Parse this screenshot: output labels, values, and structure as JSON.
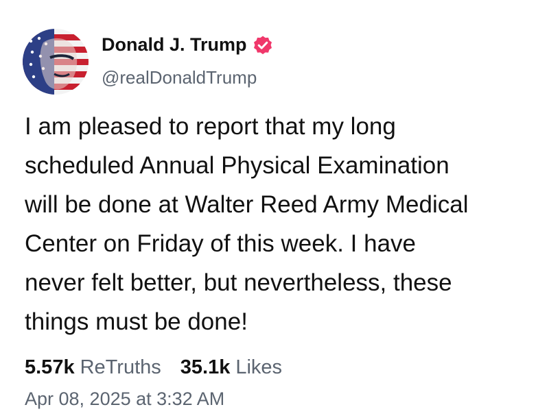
{
  "author": {
    "display_name": "Donald J. Trump",
    "handle": "@realDonaldTrump",
    "avatar_icon": "flag-portrait-avatar",
    "verified_icon": "verified-badge-icon",
    "verified_color": "#f0386b"
  },
  "post": {
    "lines": [
      "I am pleased to report that my long",
      "scheduled Annual Physical Examination",
      "will be done at Walter Reed Army Medical",
      "Center on Friday of this week. I have",
      "never felt better, but nevertheless, these",
      "things must be done!"
    ]
  },
  "stats": {
    "retruths_count": "5.57k",
    "retruths_label": "ReTruths",
    "likes_count": "35.1k",
    "likes_label": "Likes"
  },
  "timestamp": "Apr 08, 2025 at 3:32 AM"
}
